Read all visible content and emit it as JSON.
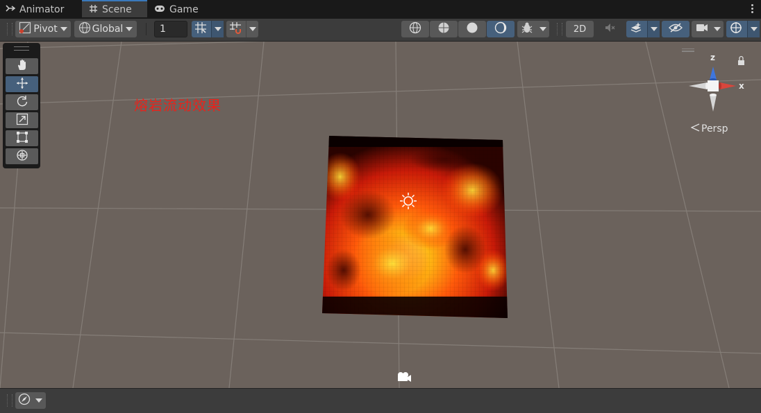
{
  "tabs": [
    {
      "label": "Animator",
      "icon": "animator-icon",
      "active": false
    },
    {
      "label": "Scene",
      "icon": "scene-grid-icon",
      "active": true
    },
    {
      "label": "Game",
      "icon": "gamepad-icon",
      "active": false
    }
  ],
  "toolbar": {
    "pivot_label": "Pivot",
    "global_label": "Global",
    "snap_value": "1",
    "mode_2d_label": "2D"
  },
  "scene": {
    "overlay_text": "熔岩流动效果",
    "projection_label": "Persp",
    "axis_x_label": "x",
    "axis_z_label": "z"
  },
  "colors": {
    "accent": "#3a79bb",
    "selected_button": "#46607c",
    "scene_background": "#6b625c",
    "overlay_text": "#e8231c"
  }
}
